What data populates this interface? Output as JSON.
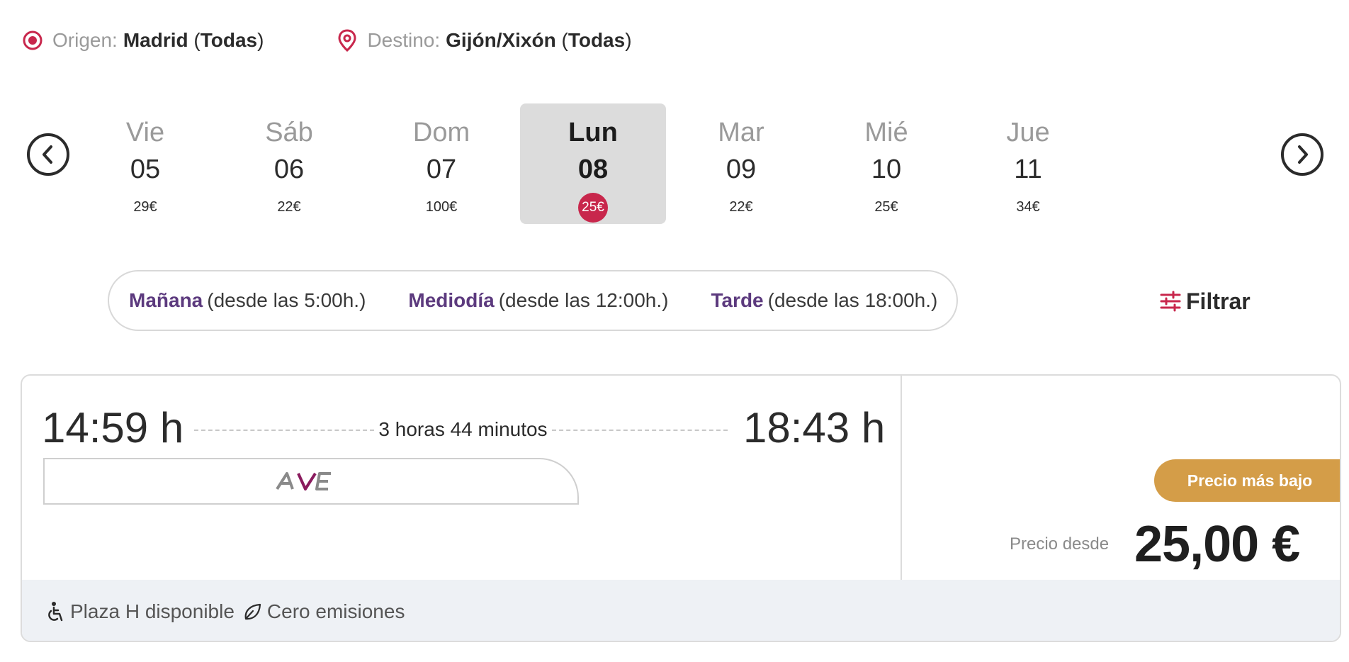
{
  "route": {
    "origin_label": "Origen:",
    "origin_value": "Madrid",
    "origin_scope": "Todas",
    "destination_label": "Destino:",
    "destination_value": "Gijón/Xixón",
    "destination_scope": "Todas"
  },
  "calendar": {
    "days": [
      {
        "name": "Vie",
        "num": "05",
        "price": "29€"
      },
      {
        "name": "Sáb",
        "num": "06",
        "price": "22€"
      },
      {
        "name": "Dom",
        "num": "07",
        "price": "100€"
      },
      {
        "name": "Lun",
        "num": "08",
        "price": "25€"
      },
      {
        "name": "Mar",
        "num": "09",
        "price": "22€"
      },
      {
        "name": "Mié",
        "num": "10",
        "price": "25€"
      },
      {
        "name": "Jue",
        "num": "11",
        "price": "34€"
      }
    ],
    "selected_day": "Lun 08"
  },
  "time_filter": {
    "morning_label": "Mañana",
    "morning_hint": "(desde las 5:00h.)",
    "midday_label": "Mediodía",
    "midday_hint": "(desde las 12:00h.)",
    "evening_label": "Tarde",
    "evening_hint": "(desde las 18:00h.)"
  },
  "filter_label": "Filtrar",
  "train": {
    "departure": "14:59 h",
    "arrival": "18:43 h",
    "duration": "3 horas 44 minutos",
    "product_logo": "AVE",
    "badge": "Precio más bajo",
    "price_label": "Precio desde",
    "price": "25,00 €",
    "features": [
      "Plaza H disponible",
      "Cero emisiones"
    ]
  },
  "colors": {
    "accent": "#c8274c",
    "filter_purple": "#5c3a7e",
    "badge": "#d49d48"
  }
}
